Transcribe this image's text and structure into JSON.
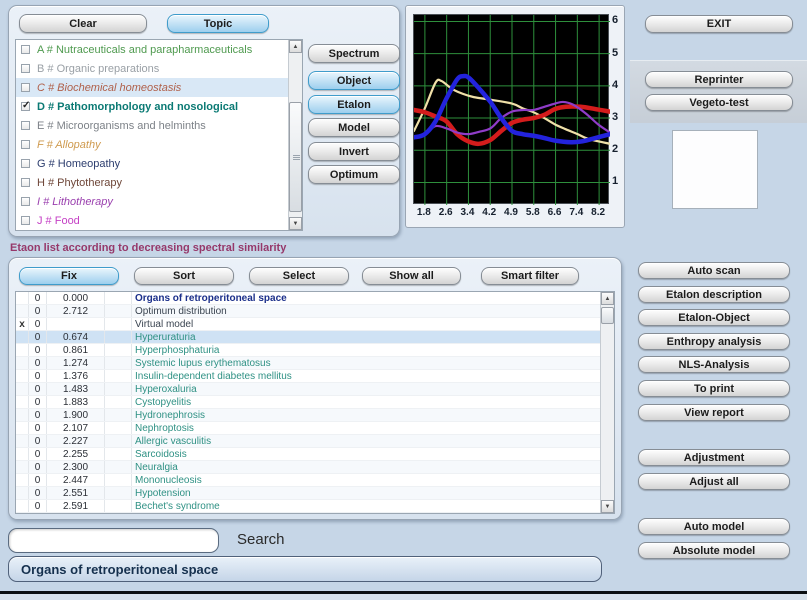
{
  "categories_panel": {
    "clear_label": "Clear",
    "topic_label": "Topic",
    "items": [
      {
        "label": "A # Nutraceuticals and parapharmaceuticals",
        "color": "#4f9a4f",
        "italic": false,
        "bold": false,
        "checked": false,
        "selected": false
      },
      {
        "label": "B # Organic preparations",
        "color": "#9aa0a6",
        "italic": false,
        "bold": false,
        "checked": false,
        "selected": false
      },
      {
        "label": "C # Biochemical homeostasis",
        "color": "#b0604a",
        "italic": true,
        "bold": false,
        "checked": false,
        "selected": true
      },
      {
        "label": "D # Pathomorphology and nosological",
        "color": "#0b7a74",
        "italic": false,
        "bold": true,
        "checked": true,
        "selected": false
      },
      {
        "label": "E # Microorganisms and helminths",
        "color": "#7d8288",
        "italic": false,
        "bold": false,
        "checked": false,
        "selected": false
      },
      {
        "label": "F # Allopathy",
        "color": "#cf9a4e",
        "italic": true,
        "bold": false,
        "checked": false,
        "selected": false
      },
      {
        "label": "G # Homeopathy",
        "color": "#2c3d6e",
        "italic": false,
        "bold": false,
        "checked": false,
        "selected": false
      },
      {
        "label": "H # Phytotherapy",
        "color": "#6e4638",
        "italic": false,
        "bold": false,
        "checked": false,
        "selected": false
      },
      {
        "label": "I # Lithotherapy",
        "color": "#9a3fae",
        "italic": true,
        "bold": false,
        "checked": false,
        "selected": false
      },
      {
        "label": "J # Food",
        "color": "#c541c5",
        "italic": false,
        "bold": false,
        "checked": false,
        "selected": false
      }
    ],
    "side_buttons": [
      {
        "label": "Spectrum",
        "active": false
      },
      {
        "label": "Object",
        "active": true
      },
      {
        "label": "Etalon",
        "active": true
      },
      {
        "label": "Model",
        "active": false
      },
      {
        "label": "Invert",
        "active": false
      },
      {
        "label": "Optimum",
        "active": false
      }
    ]
  },
  "chart_data": {
    "type": "line",
    "title": "",
    "x_ticks": [
      "1.8",
      "2.6",
      "3.4",
      "4.2",
      "4.9",
      "5.8",
      "6.6",
      "7.4",
      "8.2"
    ],
    "y_ticks": [
      1,
      2,
      3,
      4,
      5,
      6
    ],
    "y_range": [
      0.3,
      6.2
    ],
    "background": "#000000",
    "grid_color": "#2e8f3c",
    "grid": true,
    "legend": false,
    "series": [
      {
        "name": "yellow-curve",
        "color": "#f0e0a8",
        "thick": false,
        "points": [
          [
            0,
            2.6
          ],
          [
            11,
            3.3
          ],
          [
            22,
            4.1
          ],
          [
            28,
            4.15
          ],
          [
            39,
            3.9
          ],
          [
            50,
            3.75
          ],
          [
            61,
            3.65
          ],
          [
            78,
            3.57
          ],
          [
            100,
            3.45
          ],
          [
            111,
            3.3
          ],
          [
            122,
            3.18
          ],
          [
            133,
            3.0
          ],
          [
            144,
            2.8
          ],
          [
            155,
            2.65
          ],
          [
            167,
            2.5
          ],
          [
            178,
            2.35
          ],
          [
            200,
            2.2
          ]
        ]
      },
      {
        "name": "red-curve",
        "color": "#d41c1c",
        "thick": true,
        "points": [
          [
            0,
            3.25
          ],
          [
            11,
            3.18
          ],
          [
            22,
            3.05
          ],
          [
            33,
            2.9
          ],
          [
            44,
            2.5
          ],
          [
            55,
            2.28
          ],
          [
            66,
            2.2
          ],
          [
            78,
            2.32
          ],
          [
            89,
            2.6
          ],
          [
            100,
            2.85
          ],
          [
            111,
            2.95
          ],
          [
            122,
            3.0
          ],
          [
            133,
            3.1
          ],
          [
            144,
            3.28
          ],
          [
            155,
            3.35
          ],
          [
            170,
            3.35
          ],
          [
            185,
            3.28
          ],
          [
            200,
            3.2
          ]
        ]
      },
      {
        "name": "purple-curve",
        "color": "#8f3cc8",
        "thick": false,
        "points": [
          [
            0,
            2.4
          ],
          [
            11,
            2.5
          ],
          [
            22,
            2.75
          ],
          [
            33,
            2.68
          ],
          [
            44,
            2.55
          ],
          [
            55,
            2.5
          ],
          [
            66,
            2.57
          ],
          [
            78,
            2.68
          ],
          [
            89,
            3.0
          ],
          [
            100,
            3.2
          ],
          [
            111,
            3.25
          ],
          [
            122,
            3.25
          ],
          [
            133,
            3.35
          ],
          [
            144,
            3.45
          ],
          [
            152,
            3.5
          ],
          [
            162,
            3.42
          ],
          [
            175,
            3.15
          ],
          [
            188,
            2.8
          ],
          [
            200,
            2.55
          ]
        ]
      },
      {
        "name": "blue-curve",
        "color": "#2323dd",
        "thick": true,
        "points": [
          [
            0,
            2.4
          ],
          [
            11,
            2.5
          ],
          [
            22,
            2.9
          ],
          [
            33,
            3.6
          ],
          [
            44,
            4.2
          ],
          [
            50,
            4.3
          ],
          [
            56,
            4.25
          ],
          [
            67,
            3.9
          ],
          [
            78,
            3.5
          ],
          [
            89,
            3.0
          ],
          [
            100,
            2.6
          ],
          [
            111,
            2.5
          ],
          [
            122,
            2.45
          ],
          [
            133,
            2.38
          ],
          [
            144,
            2.3
          ],
          [
            160,
            2.25
          ],
          [
            172,
            2.28
          ],
          [
            185,
            2.38
          ],
          [
            200,
            2.5
          ]
        ]
      }
    ]
  },
  "top_right": {
    "exit_label": "EXIT",
    "reprinter_label": "Reprinter",
    "vegeto_label": "Vegeto-test"
  },
  "etalon_list": {
    "heading": "Etaon list according to decreasing spectral similarity",
    "toolbar": [
      {
        "label": "Fix",
        "active": true
      },
      {
        "label": "Sort",
        "active": false
      },
      {
        "label": "Select",
        "active": false
      },
      {
        "label": "Show all",
        "active": false
      },
      {
        "label": "Smart filter",
        "active": false
      }
    ],
    "rows": [
      {
        "marker": "",
        "flag": "0",
        "value": "0.000",
        "name": "Organs of retroperitoneal space",
        "style": "title",
        "selected": false
      },
      {
        "marker": "",
        "flag": "0",
        "value": "2.712",
        "name": "Optimum distribution",
        "style": "plain",
        "selected": false
      },
      {
        "marker": "x",
        "flag": "0",
        "value": "",
        "name": "Virtual model",
        "style": "plain",
        "selected": false
      },
      {
        "marker": "",
        "flag": "0",
        "value": "0.674",
        "name": "Hyperuraturia",
        "style": "etalon",
        "selected": true
      },
      {
        "marker": "",
        "flag": "0",
        "value": "0.861",
        "name": "Hyperphosphaturia",
        "style": "etalon",
        "selected": false
      },
      {
        "marker": "",
        "flag": "0",
        "value": "1.274",
        "name": "Systemic lupus erythematosus",
        "style": "etalon",
        "selected": false
      },
      {
        "marker": "",
        "flag": "0",
        "value": "1.376",
        "name": "Insulin-dependent diabetes mellitus",
        "style": "etalon",
        "selected": false
      },
      {
        "marker": "",
        "flag": "0",
        "value": "1.483",
        "name": "Hyperoxaluria",
        "style": "etalon",
        "selected": false
      },
      {
        "marker": "",
        "flag": "0",
        "value": "1.883",
        "name": "Cystopyelitis",
        "style": "etalon",
        "selected": false
      },
      {
        "marker": "",
        "flag": "0",
        "value": "1.900",
        "name": "Hydronephrosis",
        "style": "etalon",
        "selected": false
      },
      {
        "marker": "",
        "flag": "0",
        "value": "2.107",
        "name": "Nephroptosis",
        "style": "etalon",
        "selected": false
      },
      {
        "marker": "",
        "flag": "0",
        "value": "2.227",
        "name": "Allergic vasculitis",
        "style": "etalon",
        "selected": false
      },
      {
        "marker": "",
        "flag": "0",
        "value": "2.255",
        "name": "Sarcoidosis",
        "style": "etalon",
        "selected": false
      },
      {
        "marker": "",
        "flag": "0",
        "value": "2.300",
        "name": "Neuralgia",
        "style": "etalon",
        "selected": false
      },
      {
        "marker": "",
        "flag": "0",
        "value": "2.447",
        "name": "Mononucleosis",
        "style": "etalon",
        "selected": false
      },
      {
        "marker": "",
        "flag": "0",
        "value": "2.551",
        "name": "Hypotension",
        "style": "etalon",
        "selected": false
      },
      {
        "marker": "",
        "flag": "0",
        "value": "2.591",
        "name": "Bechet's syndrome",
        "style": "etalon",
        "selected": false
      }
    ]
  },
  "right_actions": {
    "group1": [
      "Auto scan",
      "Etalon description",
      "Etalon-Object",
      "Enthropy analysis",
      "NLS-Analysis",
      "To print",
      "View report"
    ],
    "group2": [
      "Adjustment",
      "Adjust all"
    ],
    "group3": [
      "Auto model",
      "Absolute model"
    ]
  },
  "search": {
    "label": "Search",
    "value": ""
  },
  "result_bar": {
    "text": "Organs of retroperitoneal space"
  },
  "accent_colors": {
    "highlight_row": "#cfe2f4",
    "blue_button_border": "#3f9ccb"
  }
}
